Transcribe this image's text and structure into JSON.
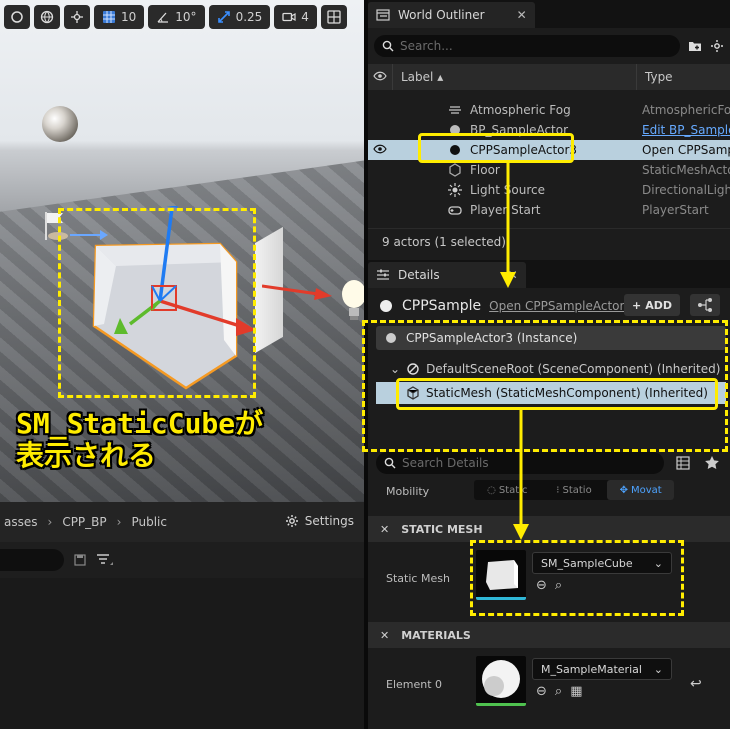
{
  "viewport": {
    "toolbar": {
      "grid_snap": "10",
      "rotate_snap": "10°",
      "scale_snap": "0.25",
      "camera_speed": "4"
    },
    "annotation": {
      "line1": "SM_StaticCubeが",
      "line2": "表示される"
    }
  },
  "content_browser": {
    "breadcrumb": [
      "asses",
      "CPP_BP",
      "Public"
    ],
    "settings_label": "Settings"
  },
  "outliner": {
    "tab_title": "World Outliner",
    "search_placeholder": "Search...",
    "col_label": "Label ▴",
    "col_type": "Type",
    "rows": [
      {
        "label": "Atmospheric Fog",
        "type": "AtmosphericFog",
        "link": false
      },
      {
        "label": "BP_SampleActor",
        "type": "Edit BP_Sample",
        "link": true
      },
      {
        "label": "CPPSampleActor3",
        "type": "Open CPPSamp",
        "link": true
      },
      {
        "label": "Floor",
        "type": "StaticMeshActor",
        "link": false
      },
      {
        "label": "Light Source",
        "type": "DirectionalLight",
        "link": false
      },
      {
        "label": "Player Start",
        "type": "PlayerStart",
        "link": false
      }
    ],
    "status": "9 actors (1 selected)"
  },
  "details": {
    "tab_title": "Details",
    "actor_name": "CPPSample",
    "actor_link": "Open CPPSampleActor",
    "add_label": "ADD",
    "instance_label": "CPPSampleActor3 (Instance)",
    "root_component": "DefaultSceneRoot (SceneComponent) (Inherited)",
    "mesh_component": "StaticMesh (StaticMeshComponent) (Inherited)",
    "search_placeholder": "Search Details",
    "mobility_label": "Mobility",
    "mobility_options": [
      "Static",
      "Statio",
      "Movat"
    ],
    "section_static_mesh": "STATIC MESH",
    "static_mesh_label": "Static Mesh",
    "static_mesh_value": "SM_SampleCube",
    "section_materials": "MATERIALS",
    "element0_label": "Element 0",
    "element0_value": "M_SampleMaterial"
  },
  "colors": {
    "annotation": "#ffec00",
    "selection": "#b9d0de",
    "link": "#66aaff",
    "accent": "#4da3ff"
  }
}
